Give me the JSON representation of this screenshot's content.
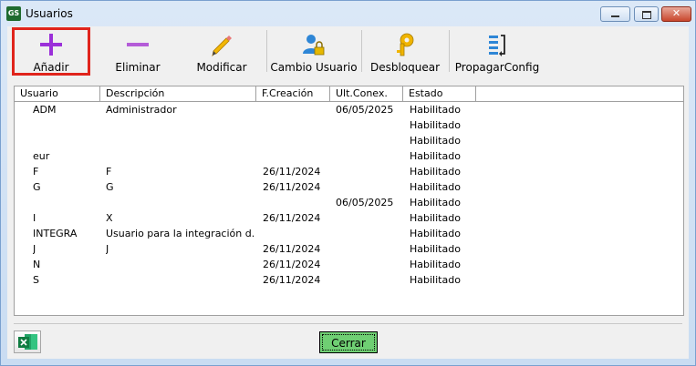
{
  "window": {
    "app_icon": "GS",
    "title": "Usuarios",
    "close_glyph": "✕"
  },
  "toolbar": {
    "add": "Añadir",
    "delete": "Eliminar",
    "edit": "Modificar",
    "change_user": "Cambio Usuario",
    "unlock": "Desbloquear",
    "propagate": "PropagarConfig"
  },
  "table": {
    "headers": [
      "Usuario",
      "Descripción",
      "F.Creación",
      "Ult.Conex.",
      "Estado"
    ],
    "rows": [
      {
        "usuario": "ADM",
        "descripcion": "Administrador",
        "creacion": "",
        "ultconex": "06/05/2025",
        "estado": "Habilitado"
      },
      {
        "usuario": "",
        "descripcion": "",
        "creacion": "",
        "ultconex": "",
        "estado": "Habilitado"
      },
      {
        "usuario": "",
        "descripcion": "",
        "creacion": "",
        "ultconex": "",
        "estado": "Habilitado"
      },
      {
        "usuario": "eur",
        "descripcion": "",
        "creacion": "",
        "ultconex": "",
        "estado": "Habilitado"
      },
      {
        "usuario": "F",
        "descripcion": "F",
        "creacion": "26/11/2024",
        "ultconex": "",
        "estado": "Habilitado"
      },
      {
        "usuario": "G",
        "descripcion": "G",
        "creacion": "26/11/2024",
        "ultconex": "",
        "estado": "Habilitado"
      },
      {
        "usuario": "",
        "descripcion": "",
        "creacion": "",
        "ultconex": "06/05/2025",
        "estado": "Habilitado"
      },
      {
        "usuario": "I",
        "descripcion": "X",
        "creacion": "26/11/2024",
        "ultconex": "",
        "estado": "Habilitado"
      },
      {
        "usuario": "INTEGRA",
        "descripcion": "Usuario para la integración d...",
        "creacion": "",
        "ultconex": "",
        "estado": "Habilitado"
      },
      {
        "usuario": "J",
        "descripcion": "J",
        "creacion": "26/11/2024",
        "ultconex": "",
        "estado": "Habilitado"
      },
      {
        "usuario": "N",
        "descripcion": "",
        "creacion": "26/11/2024",
        "ultconex": "",
        "estado": "Habilitado"
      },
      {
        "usuario": "S",
        "descripcion": "",
        "creacion": "26/11/2024",
        "ultconex": "",
        "estado": "Habilitado"
      }
    ]
  },
  "footer": {
    "excel_icon": "excel-export-icon",
    "close_label": "Cerrar"
  },
  "colors": {
    "add_accent": "#9b30d9",
    "delete_accent": "#b45cd8",
    "highlight": "#e0241c",
    "close_button": "#6fcf73"
  }
}
